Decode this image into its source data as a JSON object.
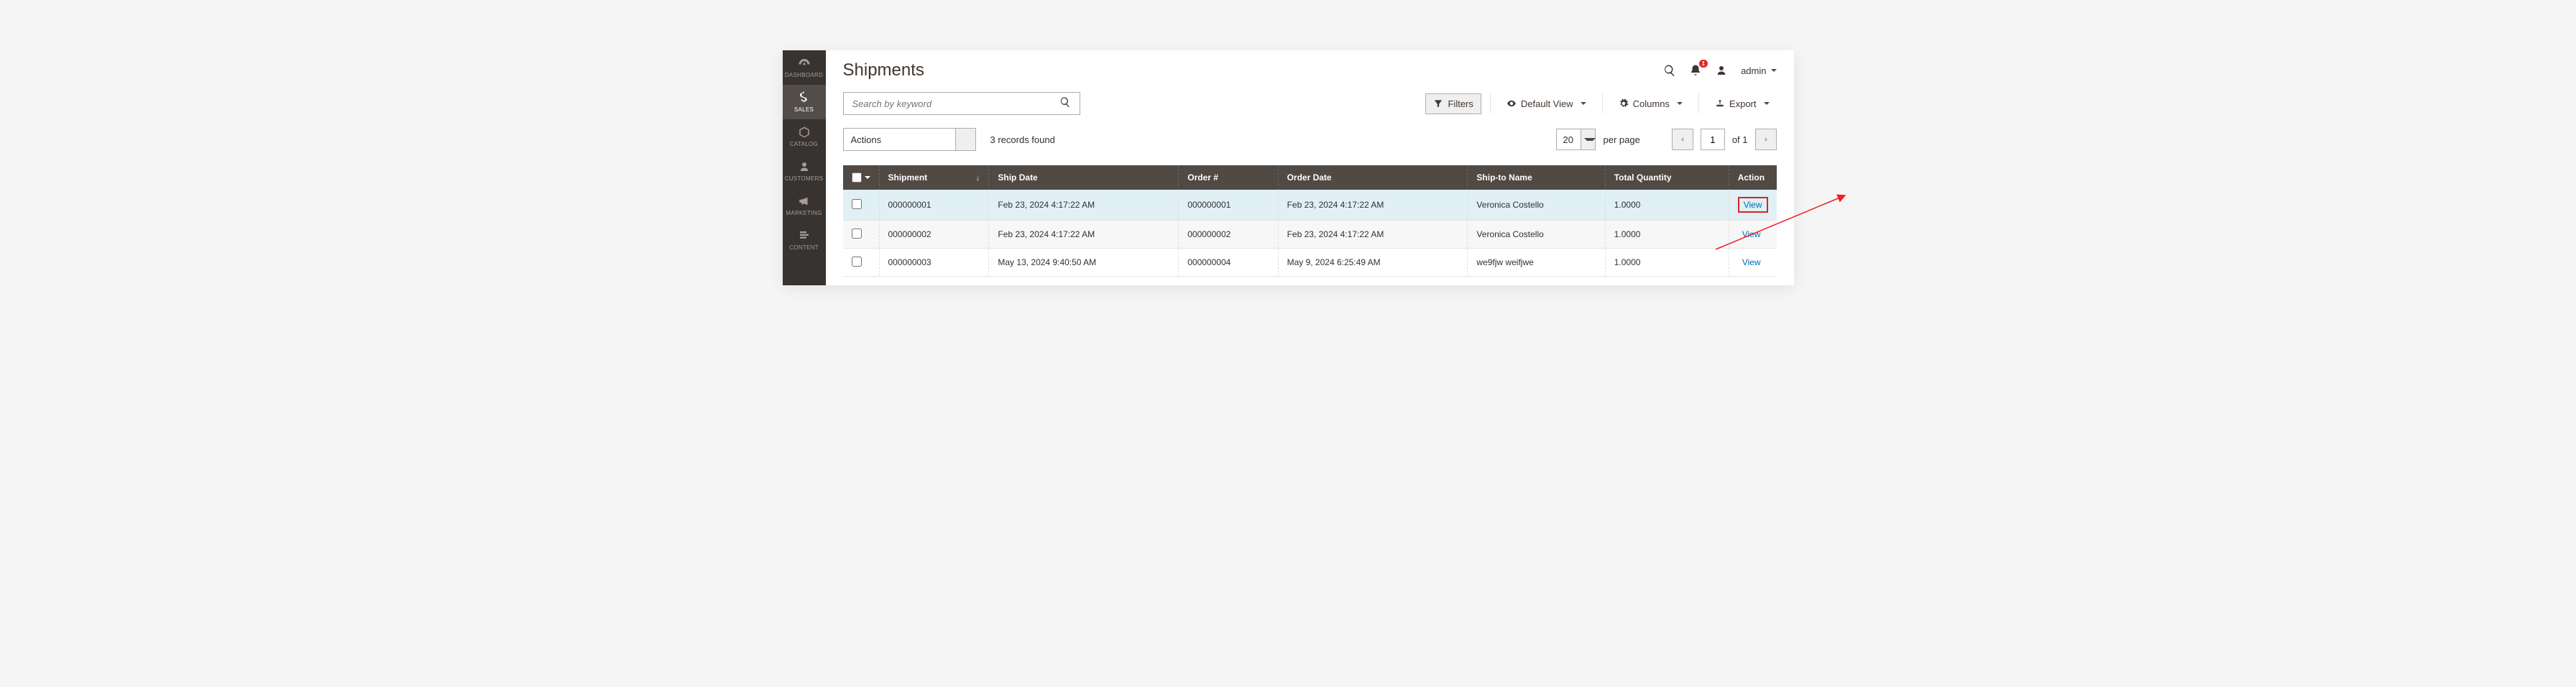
{
  "sidebar": {
    "items": [
      {
        "label": "DASHBOARD"
      },
      {
        "label": "SALES"
      },
      {
        "label": "CATALOG"
      },
      {
        "label": "CUSTOMERS"
      },
      {
        "label": "MARKETING"
      },
      {
        "label": "CONTENT"
      }
    ]
  },
  "header": {
    "title": "Shipments",
    "notification_count": "1",
    "user": "admin"
  },
  "toolbar": {
    "search_placeholder": "Search by keyword",
    "filters": "Filters",
    "default_view": "Default View",
    "columns": "Columns",
    "export": "Export"
  },
  "row2": {
    "actions": "Actions",
    "records_found": "3 records found",
    "per_page_value": "20",
    "per_page_label": "per page",
    "page": "1",
    "of_label": "of 1"
  },
  "table": {
    "headers": {
      "shipment": "Shipment",
      "ship_date": "Ship Date",
      "order": "Order #",
      "order_date": "Order Date",
      "ship_to": "Ship-to Name",
      "qty": "Total Quantity",
      "action": "Action"
    },
    "action_label": "View",
    "rows": [
      {
        "shipment": "000000001",
        "ship_date": "Feb 23, 2024 4:17:22 AM",
        "order": "000000001",
        "order_date": "Feb 23, 2024 4:17:22 AM",
        "ship_to": "Veronica Costello",
        "qty": "1.0000"
      },
      {
        "shipment": "000000002",
        "ship_date": "Feb 23, 2024 4:17:22 AM",
        "order": "000000002",
        "order_date": "Feb 23, 2024 4:17:22 AM",
        "ship_to": "Veronica Costello",
        "qty": "1.0000"
      },
      {
        "shipment": "000000003",
        "ship_date": "May 13, 2024 9:40:50 AM",
        "order": "000000004",
        "order_date": "May 9, 2024 6:25:49 AM",
        "ship_to": "we9fjw weifjwe",
        "qty": "1.0000"
      }
    ]
  }
}
